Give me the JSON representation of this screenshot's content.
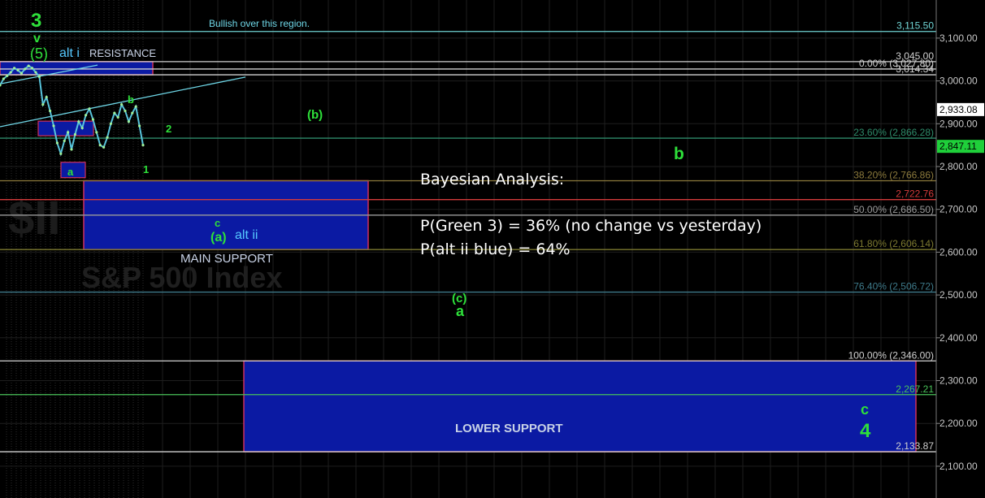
{
  "chart_data": {
    "type": "line",
    "title": "",
    "watermark": {
      "ticker": "$II",
      "name": "S&P 500 Index"
    },
    "ylim": [
      2080,
      3150
    ],
    "y_ticks": [
      "3,100.00",
      "3,000.00",
      "2,900.00",
      "2,800.00",
      "2,700.00",
      "2,600.00",
      "2,500.00",
      "2,400.00",
      "2,300.00",
      "2,200.00",
      "2,100.00"
    ],
    "y_tick_values": [
      3100,
      3000,
      2900,
      2800,
      2700,
      2600,
      2500,
      2400,
      2300,
      2200,
      2100
    ],
    "price_series": {
      "name": "",
      "color": "#58c4dc",
      "values": [
        2990,
        3005,
        3012,
        3020,
        3030,
        3025,
        3018,
        3028,
        3035,
        3030,
        3020,
        3010,
        2945,
        2962,
        2930,
        2895,
        2855,
        2830,
        2860,
        2880,
        2840,
        2875,
        2905,
        2890,
        2920,
        2935,
        2910,
        2880,
        2850,
        2845,
        2868,
        2900,
        2925,
        2915,
        2945,
        2930,
        2905,
        2925,
        2940,
        2895,
        2850
      ]
    },
    "price_tags": [
      {
        "label": "2,933.08",
        "value": 2933.08,
        "bg": "#ffffff",
        "fg": "#000000"
      },
      {
        "label": "2,847.11",
        "value": 2847.11,
        "bg": "#1fcf3a",
        "fg": "#000000"
      }
    ],
    "levels": [
      {
        "label": "3,115.50",
        "value": 3115.5,
        "color": "#6fd3d3"
      },
      {
        "label": "3,045.00",
        "value": 3045.0,
        "color": "#d0d0d0"
      },
      {
        "label": "0.00% (3,027.80)",
        "value": 3027.8,
        "color": "#d0d0d0"
      },
      {
        "label": "3,014.34",
        "value": 3014.34,
        "color": "#d0d0d0"
      },
      {
        "label": "23.60% (2,866.28)",
        "value": 2866.28,
        "color": "#2e8b6a"
      },
      {
        "label": "38.20% (2,766.86)",
        "value": 2766.86,
        "color": "#8c7a3c"
      },
      {
        "label": "2,722.76",
        "value": 2722.76,
        "color": "#d43a3a"
      },
      {
        "label": "50.00% (2,686.50)",
        "value": 2686.5,
        "color": "#9a9a9a"
      },
      {
        "label": "61.80% (2,606.14)",
        "value": 2606.14,
        "color": "#7d7a30"
      },
      {
        "label": "76.40% (2,506.72)",
        "value": 2506.72,
        "color": "#3e7a8a"
      },
      {
        "label": "100.00% (2,346.00)",
        "value": 2346.0,
        "color": "#d0d0d0"
      },
      {
        "label": "2,267.21",
        "value": 2267.21,
        "color": "#49c35a"
      },
      {
        "label": "2,133.87",
        "value": 2133.87,
        "color": "#d0d0d0"
      }
    ],
    "zones": [
      {
        "label": "RESISTANCE",
        "y1": 3045.0,
        "y2": 3014.34
      },
      {
        "label": "MAIN SUPPORT",
        "y1": 2766.86,
        "y2": 2606.14
      },
      {
        "label": "LOWER SUPPORT",
        "y1": 2346.0,
        "y2": 2133.87
      }
    ],
    "text_labels": {
      "bullish": "Bullish over this region.",
      "wave_3": "3",
      "wave_v": "v",
      "wave_5": "(5)",
      "alt_i": "alt i",
      "wave_b_small": "b",
      "wave_2": "2",
      "wave_1": "1",
      "wave_a_box": "a",
      "wave_b_paren": "(b)",
      "wave_b_big": "b",
      "wave_c_small": "c",
      "wave_a_paren": "(a)",
      "alt_ii": "alt ii",
      "wave_c_paren": "(c)",
      "wave_a_big": "a",
      "wave_c_big": "c",
      "wave_4": "4"
    }
  },
  "annotation": {
    "title": "Bayesian Analysis:",
    "line1": "P(Green 3) = 36% (no change vs yesterday)",
    "line2": "P(alt ii blue) = 64%"
  }
}
